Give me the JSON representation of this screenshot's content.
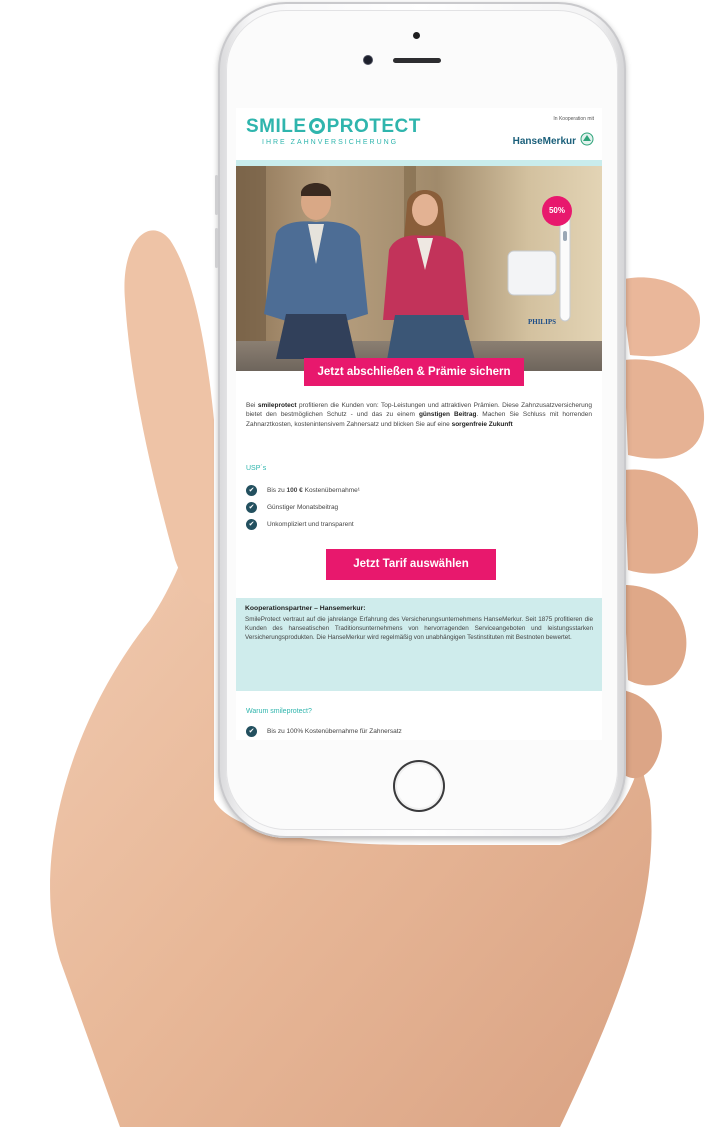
{
  "header": {
    "logo_left": "SMILE",
    "logo_right": "PROTECT",
    "logo_tagline": "IHRE ZAHNVERSICHERUNG",
    "cooperation_note": "In Kooperation mit",
    "partner_logo": "HanseMerkur"
  },
  "hero": {
    "badge": "50%",
    "brand": "PHILIPS",
    "cta_label": "Jetzt abschließen & Prämie sichern"
  },
  "intro": {
    "p1": "Bei ",
    "brand": "smileprotect",
    "p2": " profitieren die Kunden von: Top-Leistungen und attraktiven Prämien. Diese Zahnzusatzversicherung bietet den bestmöglichen Schutz - und das zu einem ",
    "bold1": "günstigen Beitrag",
    "p3": ". Machen Sie Schluss mit horrenden Zahnarztkosten, kostenintensivem Zahnersatz und blicken Sie auf eine ",
    "bold2": "sorgenfreie Zukunft"
  },
  "usp": {
    "title": "USP´s",
    "items": [
      {
        "pre": "Bis zu ",
        "bold": "100 €",
        "post": " Kostenübernahme¹"
      },
      {
        "pre": "Günstiger Monatsbeitrag",
        "bold": "",
        "post": ""
      },
      {
        "pre": "Unkompliziert und transparent",
        "bold": "",
        "post": ""
      }
    ],
    "check_icon": "✔"
  },
  "cta_tarif": "Jetzt Tarif auswählen",
  "partner": {
    "title": "Kooperationspartner – Hansemerkur:",
    "text": "SmileProtect vertraut auf die jahrelange Erfahrung des Versicherungsunternehmens HanseMerkur. Seit 1875 profitieren die Kunden des hanseatischen Traditionsunternehmens von hervorragenden Serviceangeboten und leistungsstarken Versicherungsprodukten. Die HanseMerkur wird regelmäßig von unabhängigen Testinstituten mit Bestnoten bewertet."
  },
  "why": {
    "title": "Warum smileprotect?",
    "item": "Bis zu 100% Kostenübernahme für Zahnersatz"
  },
  "colors": {
    "accent": "#e8186d",
    "brand_teal": "#2fb5ad",
    "partner_bg": "#cfecec",
    "check": "#23505f"
  }
}
